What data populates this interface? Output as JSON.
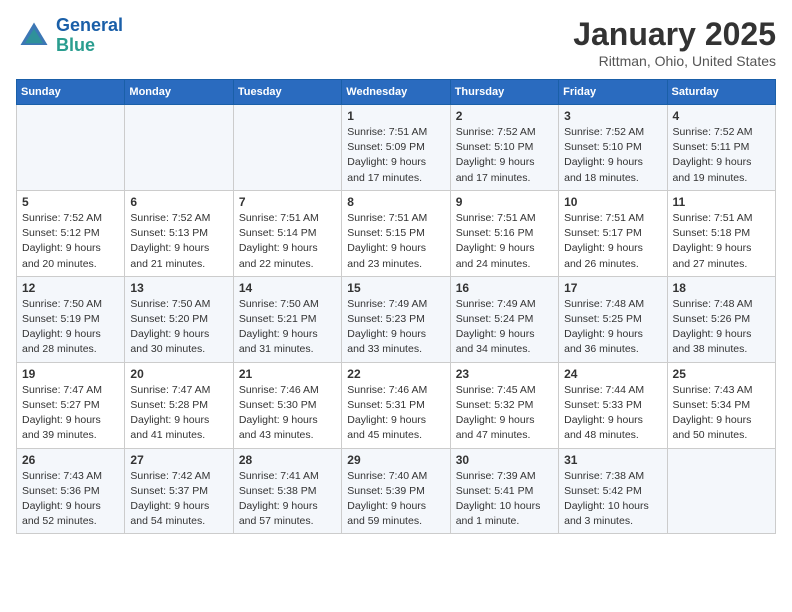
{
  "header": {
    "logo_line1": "General",
    "logo_line2": "Blue",
    "month": "January 2025",
    "location": "Rittman, Ohio, United States"
  },
  "days_of_week": [
    "Sunday",
    "Monday",
    "Tuesday",
    "Wednesday",
    "Thursday",
    "Friday",
    "Saturday"
  ],
  "weeks": [
    [
      {
        "day": "",
        "info": ""
      },
      {
        "day": "",
        "info": ""
      },
      {
        "day": "",
        "info": ""
      },
      {
        "day": "1",
        "info": "Sunrise: 7:51 AM\nSunset: 5:09 PM\nDaylight: 9 hours\nand 17 minutes."
      },
      {
        "day": "2",
        "info": "Sunrise: 7:52 AM\nSunset: 5:10 PM\nDaylight: 9 hours\nand 17 minutes."
      },
      {
        "day": "3",
        "info": "Sunrise: 7:52 AM\nSunset: 5:10 PM\nDaylight: 9 hours\nand 18 minutes."
      },
      {
        "day": "4",
        "info": "Sunrise: 7:52 AM\nSunset: 5:11 PM\nDaylight: 9 hours\nand 19 minutes."
      }
    ],
    [
      {
        "day": "5",
        "info": "Sunrise: 7:52 AM\nSunset: 5:12 PM\nDaylight: 9 hours\nand 20 minutes."
      },
      {
        "day": "6",
        "info": "Sunrise: 7:52 AM\nSunset: 5:13 PM\nDaylight: 9 hours\nand 21 minutes."
      },
      {
        "day": "7",
        "info": "Sunrise: 7:51 AM\nSunset: 5:14 PM\nDaylight: 9 hours\nand 22 minutes."
      },
      {
        "day": "8",
        "info": "Sunrise: 7:51 AM\nSunset: 5:15 PM\nDaylight: 9 hours\nand 23 minutes."
      },
      {
        "day": "9",
        "info": "Sunrise: 7:51 AM\nSunset: 5:16 PM\nDaylight: 9 hours\nand 24 minutes."
      },
      {
        "day": "10",
        "info": "Sunrise: 7:51 AM\nSunset: 5:17 PM\nDaylight: 9 hours\nand 26 minutes."
      },
      {
        "day": "11",
        "info": "Sunrise: 7:51 AM\nSunset: 5:18 PM\nDaylight: 9 hours\nand 27 minutes."
      }
    ],
    [
      {
        "day": "12",
        "info": "Sunrise: 7:50 AM\nSunset: 5:19 PM\nDaylight: 9 hours\nand 28 minutes."
      },
      {
        "day": "13",
        "info": "Sunrise: 7:50 AM\nSunset: 5:20 PM\nDaylight: 9 hours\nand 30 minutes."
      },
      {
        "day": "14",
        "info": "Sunrise: 7:50 AM\nSunset: 5:21 PM\nDaylight: 9 hours\nand 31 minutes."
      },
      {
        "day": "15",
        "info": "Sunrise: 7:49 AM\nSunset: 5:23 PM\nDaylight: 9 hours\nand 33 minutes."
      },
      {
        "day": "16",
        "info": "Sunrise: 7:49 AM\nSunset: 5:24 PM\nDaylight: 9 hours\nand 34 minutes."
      },
      {
        "day": "17",
        "info": "Sunrise: 7:48 AM\nSunset: 5:25 PM\nDaylight: 9 hours\nand 36 minutes."
      },
      {
        "day": "18",
        "info": "Sunrise: 7:48 AM\nSunset: 5:26 PM\nDaylight: 9 hours\nand 38 minutes."
      }
    ],
    [
      {
        "day": "19",
        "info": "Sunrise: 7:47 AM\nSunset: 5:27 PM\nDaylight: 9 hours\nand 39 minutes."
      },
      {
        "day": "20",
        "info": "Sunrise: 7:47 AM\nSunset: 5:28 PM\nDaylight: 9 hours\nand 41 minutes."
      },
      {
        "day": "21",
        "info": "Sunrise: 7:46 AM\nSunset: 5:30 PM\nDaylight: 9 hours\nand 43 minutes."
      },
      {
        "day": "22",
        "info": "Sunrise: 7:46 AM\nSunset: 5:31 PM\nDaylight: 9 hours\nand 45 minutes."
      },
      {
        "day": "23",
        "info": "Sunrise: 7:45 AM\nSunset: 5:32 PM\nDaylight: 9 hours\nand 47 minutes."
      },
      {
        "day": "24",
        "info": "Sunrise: 7:44 AM\nSunset: 5:33 PM\nDaylight: 9 hours\nand 48 minutes."
      },
      {
        "day": "25",
        "info": "Sunrise: 7:43 AM\nSunset: 5:34 PM\nDaylight: 9 hours\nand 50 minutes."
      }
    ],
    [
      {
        "day": "26",
        "info": "Sunrise: 7:43 AM\nSunset: 5:36 PM\nDaylight: 9 hours\nand 52 minutes."
      },
      {
        "day": "27",
        "info": "Sunrise: 7:42 AM\nSunset: 5:37 PM\nDaylight: 9 hours\nand 54 minutes."
      },
      {
        "day": "28",
        "info": "Sunrise: 7:41 AM\nSunset: 5:38 PM\nDaylight: 9 hours\nand 57 minutes."
      },
      {
        "day": "29",
        "info": "Sunrise: 7:40 AM\nSunset: 5:39 PM\nDaylight: 9 hours\nand 59 minutes."
      },
      {
        "day": "30",
        "info": "Sunrise: 7:39 AM\nSunset: 5:41 PM\nDaylight: 10 hours\nand 1 minute."
      },
      {
        "day": "31",
        "info": "Sunrise: 7:38 AM\nSunset: 5:42 PM\nDaylight: 10 hours\nand 3 minutes."
      },
      {
        "day": "",
        "info": ""
      }
    ]
  ]
}
